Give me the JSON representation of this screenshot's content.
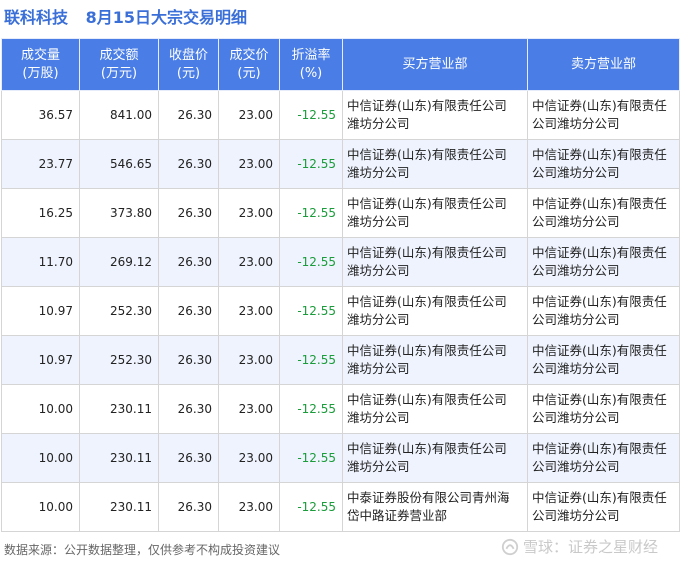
{
  "title": {
    "stock": "联科科技",
    "subject": "8月15日大宗交易明细"
  },
  "headers": [
    [
      "成交量",
      "(万股)"
    ],
    [
      "成交额",
      "(万元)"
    ],
    [
      "收盘价",
      "(元)"
    ],
    [
      "成交价",
      "(元)"
    ],
    [
      "折溢率",
      "(%)"
    ],
    [
      "买方营业部",
      ""
    ],
    [
      "卖方营业部",
      ""
    ]
  ],
  "rows": [
    [
      "36.57",
      "841.00",
      "26.30",
      "23.00",
      "-12.55",
      "中信证券(山东)有限责任公司潍坊分公司",
      "中信证券(山东)有限责任公司潍坊分公司"
    ],
    [
      "23.77",
      "546.65",
      "26.30",
      "23.00",
      "-12.55",
      "中信证券(山东)有限责任公司潍坊分公司",
      "中信证券(山东)有限责任公司潍坊分公司"
    ],
    [
      "16.25",
      "373.80",
      "26.30",
      "23.00",
      "-12.55",
      "中信证券(山东)有限责任公司潍坊分公司",
      "中信证券(山东)有限责任公司潍坊分公司"
    ],
    [
      "11.70",
      "269.12",
      "26.30",
      "23.00",
      "-12.55",
      "中信证券(山东)有限责任公司潍坊分公司",
      "中信证券(山东)有限责任公司潍坊分公司"
    ],
    [
      "10.97",
      "252.30",
      "26.30",
      "23.00",
      "-12.55",
      "中信证券(山东)有限责任公司潍坊分公司",
      "中信证券(山东)有限责任公司潍坊分公司"
    ],
    [
      "10.97",
      "252.30",
      "26.30",
      "23.00",
      "-12.55",
      "中信证券(山东)有限责任公司潍坊分公司",
      "中信证券(山东)有限责任公司潍坊分公司"
    ],
    [
      "10.00",
      "230.11",
      "26.30",
      "23.00",
      "-12.55",
      "中信证券(山东)有限责任公司潍坊分公司",
      "中信证券(山东)有限责任公司潍坊分公司"
    ],
    [
      "10.00",
      "230.11",
      "26.30",
      "23.00",
      "-12.55",
      "中信证券(山东)有限责任公司潍坊分公司",
      "中信证券(山东)有限责任公司潍坊分公司"
    ],
    [
      "10.00",
      "230.11",
      "26.30",
      "23.00",
      "-12.55",
      "中泰证券股份有限公司青州海岱中路证券营业部",
      "中信证券(山东)有限责任公司潍坊分公司"
    ]
  ],
  "footer": {
    "source": "数据来源：公开数据整理，仅供参考不构成投资建议"
  },
  "brand": {
    "text": "雪球：证券之星财经"
  },
  "watermark": {
    "text": "证券之星"
  },
  "colors": {
    "header_bg": "#4a7ee6",
    "title": "#3a6fd8",
    "negative": "#1a9c3a",
    "row_alt": "#eef3fd"
  }
}
